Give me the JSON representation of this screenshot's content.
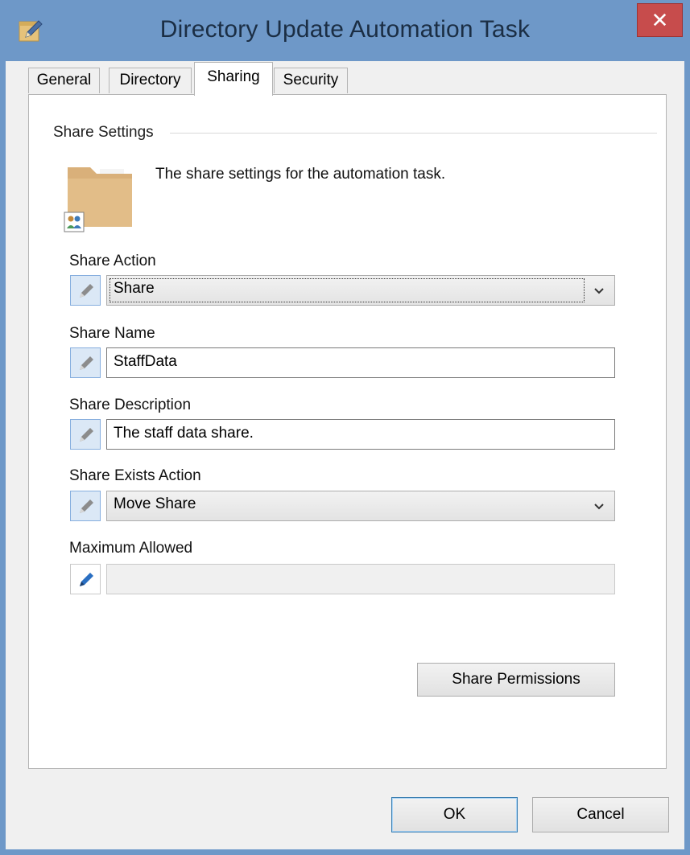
{
  "window": {
    "title": "Directory Update Automation Task",
    "close_glyph": "✕",
    "app_icon": "edit-document-icon",
    "frame_color": "#6e98c8"
  },
  "tabs": [
    {
      "label": "General",
      "active": false
    },
    {
      "label": "Directory",
      "active": false
    },
    {
      "label": "Sharing",
      "active": true
    },
    {
      "label": "Security",
      "active": false
    }
  ],
  "sharing": {
    "group_title": "Share Settings",
    "description": "The share settings for the automation task.",
    "folder_icon": "shared-folder-icon",
    "share_action": {
      "label": "Share Action",
      "value": "Share"
    },
    "share_name": {
      "label": "Share Name",
      "value": "StaffData"
    },
    "share_description": {
      "label": "Share Description",
      "value": "The staff data share."
    },
    "share_exists_action": {
      "label": "Share Exists Action",
      "value": "Move Share"
    },
    "maximum_allowed": {
      "label": "Maximum Allowed",
      "value": ""
    },
    "permissions_button": "Share Permissions"
  },
  "footer": {
    "ok_label": "OK",
    "cancel_label": "Cancel"
  }
}
